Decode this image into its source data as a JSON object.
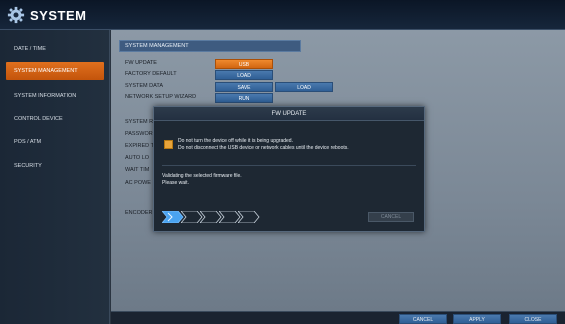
{
  "header": {
    "title": "SYSTEM",
    "icon": "gear-icon"
  },
  "sidebar": {
    "items": [
      {
        "label": "DATE / TIME"
      },
      {
        "label": "SYSTEM MANAGEMENT",
        "active": true
      },
      {
        "label": "SYSTEM INFORMATION"
      },
      {
        "label": "CONTROL DEVICE"
      },
      {
        "label": "POS / ATM"
      },
      {
        "label": "SECURITY"
      }
    ]
  },
  "main": {
    "section_title": "SYSTEM MANAGEMENT",
    "rows": [
      {
        "label": "FW UPDATE",
        "buttons": [
          "USB"
        ]
      },
      {
        "label": "FACTORY DEFAULT",
        "buttons": [
          "LOAD"
        ]
      },
      {
        "label": "SYSTEM DATA",
        "buttons": [
          "SAVE",
          "LOAD"
        ]
      },
      {
        "label": "NETWORK SETUP WIZARD",
        "buttons": [
          "RUN"
        ]
      }
    ],
    "partial_labels": [
      "SYSTEM R",
      "PASSWOR",
      "EXPIRED T",
      "AUTO LO",
      "WAIT TIM",
      "AC POWE",
      "ENCODER"
    ]
  },
  "dialog": {
    "title": "FW UPDATE",
    "warning_line1": "Do not turn the device off while it is being upgraded.",
    "warning_line2": "Do not disconnect the USB device or network cables until the device reboots.",
    "message_line1": "Validating the selected firmware file.",
    "message_line2": "Please wait.",
    "cancel_label": "CANCEL",
    "progress_steps_total": 5,
    "progress_steps_done": 1
  },
  "footer": {
    "cancel_label": "CANCEL",
    "apply_label": "APPLY",
    "close_label": "CLOSE"
  },
  "colors": {
    "accent": "#e0701e",
    "button": "#3a6ca3",
    "header": "#3e5b80"
  }
}
